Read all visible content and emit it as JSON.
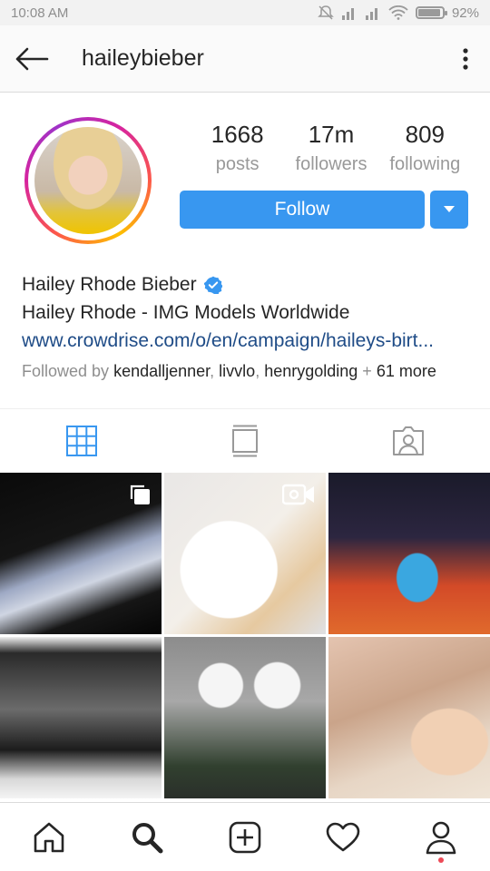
{
  "status_bar": {
    "time": "10:08 AM",
    "battery_percent": "92%",
    "battery_level": 0.92,
    "icons": [
      "mute-icon",
      "signal-icon",
      "signal-icon",
      "wifi-icon",
      "battery-icon"
    ]
  },
  "header": {
    "username": "haileybieber",
    "back_icon": "arrow-left-icon",
    "more_icon": "kebab-menu-icon"
  },
  "profile": {
    "stats": [
      {
        "value": "1668",
        "label": "posts"
      },
      {
        "value": "17m",
        "label": "followers"
      },
      {
        "value": "809",
        "label": "following"
      }
    ],
    "follow_label": "Follow",
    "name": "Hailey Rhode Bieber",
    "verified": true,
    "bio": "Hailey Rhode - IMG Models Worldwide",
    "link": "www.crowdrise.com/o/en/campaign/haileys-birt...",
    "followed_by": {
      "prefix": "Followed by",
      "users": [
        "kendalljenner",
        "livvlo",
        "henrygolding"
      ],
      "separator": ", ",
      "plus": "+",
      "more": "61 more"
    }
  },
  "tabs": [
    {
      "icon": "grid-icon",
      "active": true
    },
    {
      "icon": "feed-icon",
      "active": false
    },
    {
      "icon": "tagged-icon",
      "active": false
    }
  ],
  "posts": [
    {
      "badge": "multiple-photos-icon"
    },
    {
      "badge": "video-icon"
    },
    {
      "badge": ""
    },
    {
      "badge": ""
    },
    {
      "badge": ""
    },
    {
      "badge": ""
    }
  ],
  "bottom_nav": [
    "home-icon",
    "search-icon",
    "add-post-icon",
    "activity-heart-icon",
    "profile-icon"
  ],
  "colors": {
    "accent": "#3897f0",
    "link": "#1f4c87",
    "muted": "#999999",
    "notification": "#ed4956"
  }
}
